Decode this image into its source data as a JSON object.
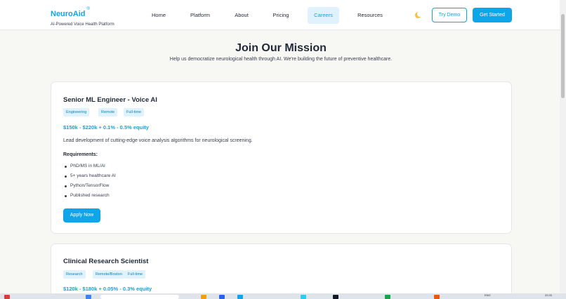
{
  "brand": {
    "name": "NeuroAid",
    "mark": "®",
    "tagline": "AI-Powered Voice Health Platform"
  },
  "nav": {
    "items": [
      {
        "label": "Home",
        "active": false
      },
      {
        "label": "Platform",
        "active": false
      },
      {
        "label": "About",
        "active": false
      },
      {
        "label": "Pricing",
        "active": false
      },
      {
        "label": "Careers",
        "active": true
      },
      {
        "label": "Resources",
        "active": false
      }
    ],
    "theme_icon": "moon-icon",
    "try_demo": "Try Demo",
    "get_started": "Get Started"
  },
  "hero": {
    "title": "Join Our Mission",
    "subtitle": "Help us democratize neurological health through AI. We're building the future of preventive healthcare."
  },
  "jobs": [
    {
      "title": "Senior ML Engineer - Voice AI",
      "tags": [
        "Engineering",
        "Remote",
        "Full-time"
      ],
      "salary": "$150k - $220k + 0.1% - 0.5% equity",
      "description": "Lead development of cutting-edge voice analysis algorithms for neurological screening.",
      "requirements_label": "Requirements:",
      "requirements": [
        "PhD/MS in ML/AI",
        "5+ years healthcare AI",
        "Python/TensorFlow",
        "Published research"
      ],
      "apply_label": "Apply Now"
    },
    {
      "title": "Clinical Research Scientist",
      "tags": [
        "Research",
        "Remote/Boston",
        "Full-time"
      ],
      "salary": "$120k - $180k + 0.05% - 0.3% equity"
    }
  ],
  "colors": {
    "accent": "#0ea5e9",
    "tag_bg": "#e0f2fe",
    "page_bg": "#f7f7f3"
  },
  "taskbar": {
    "lang": "ENG",
    "time": "22:20"
  }
}
